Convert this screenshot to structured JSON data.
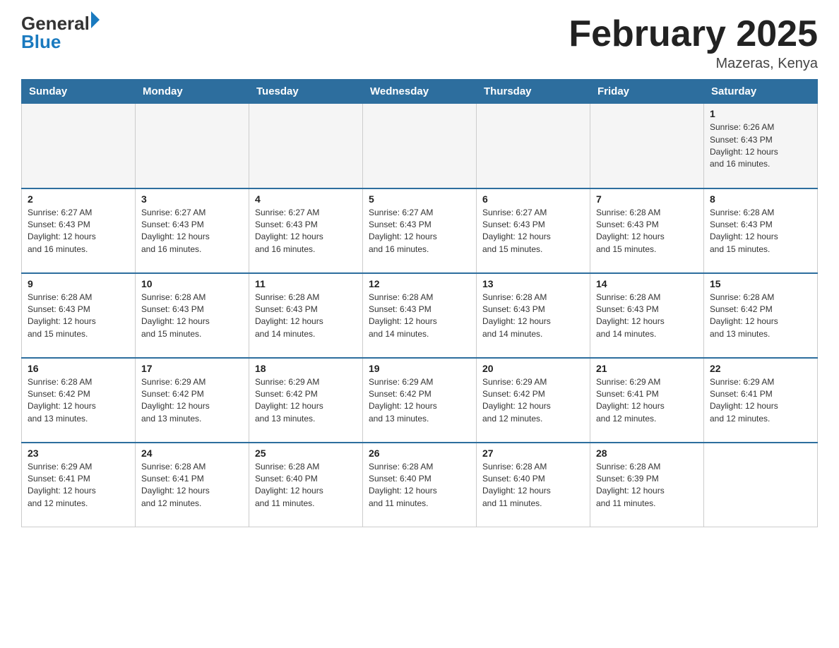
{
  "header": {
    "logo_general": "General",
    "logo_blue": "Blue",
    "month_title": "February 2025",
    "location": "Mazeras, Kenya"
  },
  "days_of_week": [
    "Sunday",
    "Monday",
    "Tuesday",
    "Wednesday",
    "Thursday",
    "Friday",
    "Saturday"
  ],
  "weeks": [
    [
      {
        "day": "",
        "info": ""
      },
      {
        "day": "",
        "info": ""
      },
      {
        "day": "",
        "info": ""
      },
      {
        "day": "",
        "info": ""
      },
      {
        "day": "",
        "info": ""
      },
      {
        "day": "",
        "info": ""
      },
      {
        "day": "1",
        "info": "Sunrise: 6:26 AM\nSunset: 6:43 PM\nDaylight: 12 hours\nand 16 minutes."
      }
    ],
    [
      {
        "day": "2",
        "info": "Sunrise: 6:27 AM\nSunset: 6:43 PM\nDaylight: 12 hours\nand 16 minutes."
      },
      {
        "day": "3",
        "info": "Sunrise: 6:27 AM\nSunset: 6:43 PM\nDaylight: 12 hours\nand 16 minutes."
      },
      {
        "day": "4",
        "info": "Sunrise: 6:27 AM\nSunset: 6:43 PM\nDaylight: 12 hours\nand 16 minutes."
      },
      {
        "day": "5",
        "info": "Sunrise: 6:27 AM\nSunset: 6:43 PM\nDaylight: 12 hours\nand 16 minutes."
      },
      {
        "day": "6",
        "info": "Sunrise: 6:27 AM\nSunset: 6:43 PM\nDaylight: 12 hours\nand 15 minutes."
      },
      {
        "day": "7",
        "info": "Sunrise: 6:28 AM\nSunset: 6:43 PM\nDaylight: 12 hours\nand 15 minutes."
      },
      {
        "day": "8",
        "info": "Sunrise: 6:28 AM\nSunset: 6:43 PM\nDaylight: 12 hours\nand 15 minutes."
      }
    ],
    [
      {
        "day": "9",
        "info": "Sunrise: 6:28 AM\nSunset: 6:43 PM\nDaylight: 12 hours\nand 15 minutes."
      },
      {
        "day": "10",
        "info": "Sunrise: 6:28 AM\nSunset: 6:43 PM\nDaylight: 12 hours\nand 15 minutes."
      },
      {
        "day": "11",
        "info": "Sunrise: 6:28 AM\nSunset: 6:43 PM\nDaylight: 12 hours\nand 14 minutes."
      },
      {
        "day": "12",
        "info": "Sunrise: 6:28 AM\nSunset: 6:43 PM\nDaylight: 12 hours\nand 14 minutes."
      },
      {
        "day": "13",
        "info": "Sunrise: 6:28 AM\nSunset: 6:43 PM\nDaylight: 12 hours\nand 14 minutes."
      },
      {
        "day": "14",
        "info": "Sunrise: 6:28 AM\nSunset: 6:43 PM\nDaylight: 12 hours\nand 14 minutes."
      },
      {
        "day": "15",
        "info": "Sunrise: 6:28 AM\nSunset: 6:42 PM\nDaylight: 12 hours\nand 13 minutes."
      }
    ],
    [
      {
        "day": "16",
        "info": "Sunrise: 6:28 AM\nSunset: 6:42 PM\nDaylight: 12 hours\nand 13 minutes."
      },
      {
        "day": "17",
        "info": "Sunrise: 6:29 AM\nSunset: 6:42 PM\nDaylight: 12 hours\nand 13 minutes."
      },
      {
        "day": "18",
        "info": "Sunrise: 6:29 AM\nSunset: 6:42 PM\nDaylight: 12 hours\nand 13 minutes."
      },
      {
        "day": "19",
        "info": "Sunrise: 6:29 AM\nSunset: 6:42 PM\nDaylight: 12 hours\nand 13 minutes."
      },
      {
        "day": "20",
        "info": "Sunrise: 6:29 AM\nSunset: 6:42 PM\nDaylight: 12 hours\nand 12 minutes."
      },
      {
        "day": "21",
        "info": "Sunrise: 6:29 AM\nSunset: 6:41 PM\nDaylight: 12 hours\nand 12 minutes."
      },
      {
        "day": "22",
        "info": "Sunrise: 6:29 AM\nSunset: 6:41 PM\nDaylight: 12 hours\nand 12 minutes."
      }
    ],
    [
      {
        "day": "23",
        "info": "Sunrise: 6:29 AM\nSunset: 6:41 PM\nDaylight: 12 hours\nand 12 minutes."
      },
      {
        "day": "24",
        "info": "Sunrise: 6:28 AM\nSunset: 6:41 PM\nDaylight: 12 hours\nand 12 minutes."
      },
      {
        "day": "25",
        "info": "Sunrise: 6:28 AM\nSunset: 6:40 PM\nDaylight: 12 hours\nand 11 minutes."
      },
      {
        "day": "26",
        "info": "Sunrise: 6:28 AM\nSunset: 6:40 PM\nDaylight: 12 hours\nand 11 minutes."
      },
      {
        "day": "27",
        "info": "Sunrise: 6:28 AM\nSunset: 6:40 PM\nDaylight: 12 hours\nand 11 minutes."
      },
      {
        "day": "28",
        "info": "Sunrise: 6:28 AM\nSunset: 6:39 PM\nDaylight: 12 hours\nand 11 minutes."
      },
      {
        "day": "",
        "info": ""
      }
    ]
  ]
}
